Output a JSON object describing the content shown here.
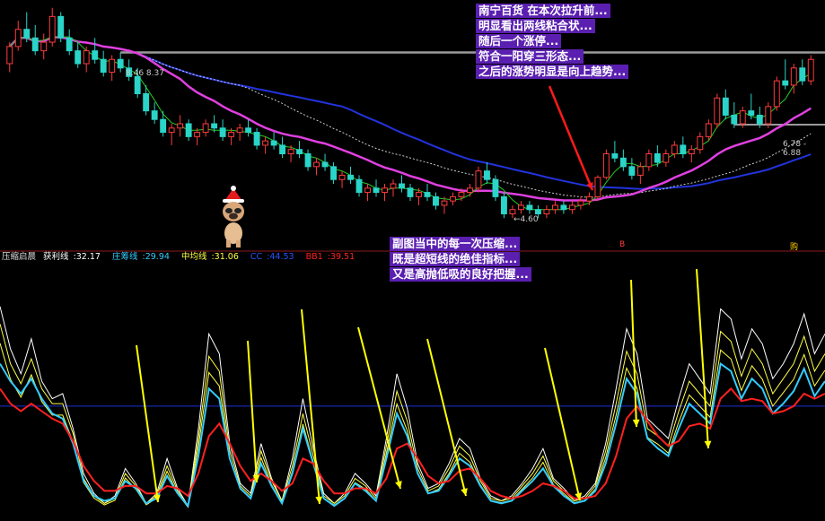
{
  "colors": {
    "background": "#000000",
    "bull": "#ff3b3b",
    "bear": "#2ad4c8",
    "ma_magenta": "#e040e0",
    "ma_blue": "#2233dd",
    "ma_dotted": "#cccccc",
    "ma_green": "#22cc22",
    "annotation_bg": "#5a1fb0",
    "sub_white": "#ffffff",
    "sub_yellow": "#ffff44",
    "sub_cyan": "#33ccff",
    "sub_red": "#ff2020",
    "arrow_yellow": "#ffff00",
    "arrow_red": "#ff1a1a"
  },
  "annotation_main": [
    "南宁百货 在本次拉升前...",
    "明显看出两线粘合状...",
    "随后一个涨停...",
    "符合一阳穿三形态...",
    "之后的涨势明显是向上趋势..."
  ],
  "annotation_sub": [
    "副图当中的每一次压缩...",
    "既是超短线的绝佳指标...",
    "又是高抛低吸的良好把握..."
  ],
  "price_labels": {
    "high_left": "8.46",
    "high_left2": "8.37",
    "low": "4.60",
    "right_a": "6.78",
    "right_b": "6.88"
  },
  "markers": {
    "buy_left": "B",
    "buy_right": "购"
  },
  "mascot_icon": "pug-with-santa-hat-icon",
  "legend": {
    "title": "压缩启晨",
    "items": [
      {
        "label": "获利线",
        "value": "32.17",
        "color": "#ffffff"
      },
      {
        "label": "庄筹线",
        "value": "29.94",
        "color": "#33ccff"
      },
      {
        "label": "中均线",
        "value": "31.06",
        "color": "#ffff44"
      },
      {
        "label": "CC",
        "value": "44.53",
        "color": "#2255ff"
      },
      {
        "label": "BB1",
        "value": "39.51",
        "color": "#ff2020"
      }
    ]
  },
  "chart_data": {
    "type": "candlestick",
    "main": {
      "key_levels": {
        "left_high": 8.46,
        "low": 4.6,
        "right_level": 6.78
      },
      "ylim": [
        4.0,
        9.6
      ],
      "candles": [
        [
          8.2,
          8.7,
          8.0,
          8.6
        ],
        [
          8.6,
          9.2,
          8.5,
          9.0
        ],
        [
          9.0,
          9.4,
          8.7,
          8.8
        ],
        [
          8.8,
          9.1,
          8.4,
          8.5
        ],
        [
          8.5,
          8.9,
          8.3,
          8.7
        ],
        [
          8.7,
          9.5,
          8.6,
          9.3
        ],
        [
          9.3,
          9.4,
          8.7,
          8.8
        ],
        [
          8.8,
          9.0,
          8.4,
          8.5
        ],
        [
          8.5,
          8.7,
          8.1,
          8.2
        ],
        [
          8.2,
          8.6,
          8.0,
          8.5
        ],
        [
          8.5,
          8.8,
          8.2,
          8.3
        ],
        [
          8.3,
          8.5,
          7.9,
          8.0
        ],
        [
          8.0,
          8.4,
          7.8,
          8.3
        ],
        [
          8.3,
          8.46,
          8.0,
          8.1
        ],
        [
          8.1,
          8.3,
          7.8,
          7.9
        ],
        [
          7.9,
          8.1,
          7.4,
          7.5
        ],
        [
          7.5,
          7.7,
          7.0,
          7.1
        ],
        [
          7.1,
          7.3,
          6.8,
          6.9
        ],
        [
          6.9,
          7.1,
          6.5,
          6.6
        ],
        [
          6.6,
          6.8,
          6.3,
          6.7
        ],
        [
          6.7,
          7.0,
          6.5,
          6.8
        ],
        [
          6.8,
          6.9,
          6.4,
          6.5
        ],
        [
          6.5,
          6.7,
          6.3,
          6.6
        ],
        [
          6.6,
          6.9,
          6.5,
          6.8
        ],
        [
          6.8,
          7.0,
          6.6,
          6.7
        ],
        [
          6.7,
          6.9,
          6.4,
          6.5
        ],
        [
          6.5,
          6.7,
          6.3,
          6.6
        ],
        [
          6.6,
          6.8,
          6.4,
          6.7
        ],
        [
          6.7,
          6.9,
          6.5,
          6.6
        ],
        [
          6.6,
          6.7,
          6.2,
          6.3
        ],
        [
          6.3,
          6.5,
          6.1,
          6.4
        ],
        [
          6.4,
          6.6,
          6.2,
          6.3
        ],
        [
          6.3,
          6.5,
          6.0,
          6.1
        ],
        [
          6.1,
          6.3,
          5.9,
          6.2
        ],
        [
          6.2,
          6.4,
          6.0,
          6.1
        ],
        [
          6.1,
          6.2,
          5.7,
          5.8
        ],
        [
          5.8,
          6.0,
          5.6,
          5.9
        ],
        [
          5.9,
          6.1,
          5.7,
          5.8
        ],
        [
          5.8,
          5.9,
          5.4,
          5.5
        ],
        [
          5.5,
          5.7,
          5.3,
          5.6
        ],
        [
          5.6,
          5.8,
          5.4,
          5.5
        ],
        [
          5.5,
          5.6,
          5.1,
          5.2
        ],
        [
          5.2,
          5.4,
          5.0,
          5.3
        ],
        [
          5.3,
          5.5,
          5.1,
          5.2
        ],
        [
          5.2,
          5.4,
          5.0,
          5.3
        ],
        [
          5.3,
          5.5,
          5.1,
          5.4
        ],
        [
          5.4,
          5.6,
          5.2,
          5.3
        ],
        [
          5.3,
          5.4,
          5.0,
          5.1
        ],
        [
          5.1,
          5.3,
          4.9,
          5.2
        ],
        [
          5.2,
          5.4,
          5.0,
          5.1
        ],
        [
          5.1,
          5.2,
          4.8,
          4.9
        ],
        [
          4.9,
          5.1,
          4.7,
          5.0
        ],
        [
          5.0,
          5.2,
          4.9,
          5.1
        ],
        [
          5.1,
          5.3,
          5.0,
          5.2
        ],
        [
          5.2,
          5.4,
          5.1,
          5.3
        ],
        [
          5.3,
          5.8,
          5.2,
          5.7
        ],
        [
          5.7,
          5.9,
          5.4,
          5.5
        ],
        [
          5.5,
          5.6,
          5.0,
          5.1
        ],
        [
          5.1,
          5.2,
          4.6,
          4.7
        ],
        [
          4.7,
          4.9,
          4.6,
          4.8
        ],
        [
          4.8,
          5.0,
          4.7,
          4.9
        ],
        [
          4.9,
          5.0,
          4.7,
          4.8
        ],
        [
          4.8,
          4.9,
          4.6,
          4.7
        ],
        [
          4.7,
          4.9,
          4.6,
          4.8
        ],
        [
          4.8,
          5.0,
          4.7,
          4.9
        ],
        [
          4.9,
          5.0,
          4.7,
          4.8
        ],
        [
          4.8,
          5.0,
          4.7,
          4.9
        ],
        [
          4.9,
          5.1,
          4.8,
          5.0
        ],
        [
          5.0,
          5.2,
          4.9,
          5.1
        ],
        [
          5.1,
          5.6,
          5.0,
          5.55
        ],
        [
          5.55,
          6.2,
          5.5,
          6.1
        ],
        [
          6.1,
          6.4,
          5.9,
          6.0
        ],
        [
          6.0,
          6.2,
          5.7,
          5.8
        ],
        [
          5.8,
          6.0,
          5.5,
          5.6
        ],
        [
          5.6,
          5.9,
          5.4,
          5.8
        ],
        [
          5.8,
          6.2,
          5.7,
          6.1
        ],
        [
          6.1,
          6.3,
          5.8,
          5.9
        ],
        [
          5.9,
          6.2,
          5.8,
          6.1
        ],
        [
          6.1,
          6.4,
          6.0,
          6.3
        ],
        [
          6.3,
          6.5,
          6.0,
          6.1
        ],
        [
          6.1,
          6.3,
          5.9,
          6.2
        ],
        [
          6.2,
          6.6,
          6.1,
          6.5
        ],
        [
          6.5,
          6.9,
          6.4,
          6.8
        ],
        [
          6.8,
          7.5,
          6.7,
          7.4
        ],
        [
          7.4,
          7.6,
          6.9,
          7.0
        ],
        [
          7.0,
          7.3,
          6.7,
          6.8
        ],
        [
          6.8,
          7.2,
          6.7,
          7.1
        ],
        [
          7.1,
          7.5,
          6.9,
          7.0
        ],
        [
          7.0,
          7.2,
          6.7,
          6.8
        ],
        [
          6.8,
          7.3,
          6.7,
          7.2
        ],
        [
          7.2,
          7.9,
          7.1,
          7.8
        ],
        [
          7.8,
          8.3,
          7.6,
          7.7
        ],
        [
          7.7,
          8.2,
          7.5,
          8.1
        ],
        [
          8.1,
          8.3,
          7.7,
          7.8
        ],
        [
          7.8,
          8.4,
          7.7,
          8.3
        ]
      ]
    },
    "sub": {
      "series": [
        {
          "name": "获利线",
          "values": [
            85,
            68,
            58,
            72,
            55,
            48,
            50,
            36,
            18,
            10,
            6,
            9,
            20,
            14,
            6,
            10,
            24,
            12,
            5,
            36,
            74,
            66,
            30,
            14,
            10,
            30,
            16,
            7,
            24,
            48,
            28,
            10,
            6,
            10,
            18,
            14,
            9,
            32,
            58,
            44,
            22,
            12,
            14,
            22,
            32,
            28,
            16,
            9,
            7,
            9,
            14,
            20,
            28,
            16,
            12,
            7,
            9,
            14,
            30,
            52,
            76,
            66,
            40,
            36,
            32,
            48,
            62,
            56,
            50,
            84,
            80,
            64,
            76,
            70,
            56,
            62,
            70,
            82,
            66,
            74
          ]
        },
        {
          "name": "中均线",
          "values": [
            78,
            62,
            54,
            64,
            52,
            46,
            46,
            34,
            16,
            9,
            6,
            8,
            18,
            13,
            6,
            9,
            21,
            11,
            5,
            32,
            65,
            59,
            27,
            13,
            9,
            27,
            15,
            7,
            21,
            42,
            25,
            9,
            6,
            9,
            16,
            13,
            8,
            29,
            51,
            39,
            20,
            11,
            13,
            20,
            29,
            25,
            15,
            8,
            7,
            8,
            13,
            18,
            25,
            15,
            11,
            7,
            8,
            13,
            27,
            46,
            67,
            58,
            36,
            33,
            29,
            43,
            55,
            50,
            45,
            75,
            71,
            57,
            68,
            62,
            50,
            56,
            62,
            73,
            59,
            66
          ]
        },
        {
          "name": "庄筹线",
          "values": [
            62,
            55,
            50,
            56,
            48,
            42,
            40,
            30,
            15,
            9,
            7,
            8,
            15,
            12,
            6,
            8,
            17,
            10,
            5,
            25,
            52,
            48,
            24,
            12,
            8,
            22,
            13,
            6,
            18,
            36,
            22,
            8,
            5,
            8,
            14,
            11,
            7,
            24,
            42,
            33,
            18,
            10,
            11,
            17,
            24,
            21,
            13,
            7,
            6,
            7,
            11,
            15,
            20,
            13,
            9,
            6,
            7,
            11,
            22,
            38,
            56,
            50,
            32,
            28,
            25,
            36,
            46,
            42,
            38,
            62,
            59,
            48,
            56,
            52,
            42,
            46,
            51,
            60,
            49,
            55
          ]
        },
        {
          "name": "BB1",
          "values": [
            52,
            46,
            43,
            46,
            43,
            40,
            38,
            31,
            21,
            15,
            11,
            11,
            13,
            13,
            10,
            10,
            13,
            12,
            9,
            18,
            33,
            38,
            30,
            21,
            15,
            18,
            15,
            11,
            14,
            24,
            22,
            15,
            10,
            10,
            12,
            12,
            10,
            16,
            28,
            30,
            24,
            17,
            14,
            15,
            19,
            20,
            16,
            11,
            9,
            8,
            9,
            11,
            14,
            13,
            11,
            8,
            8,
            9,
            14,
            25,
            40,
            45,
            39,
            33,
            29,
            31,
            37,
            38,
            36,
            48,
            52,
            47,
            48,
            47,
            42,
            43,
            45,
            50,
            48,
            50
          ]
        }
      ],
      "ylim": [
        0,
        100
      ],
      "ref_line": 45
    }
  }
}
